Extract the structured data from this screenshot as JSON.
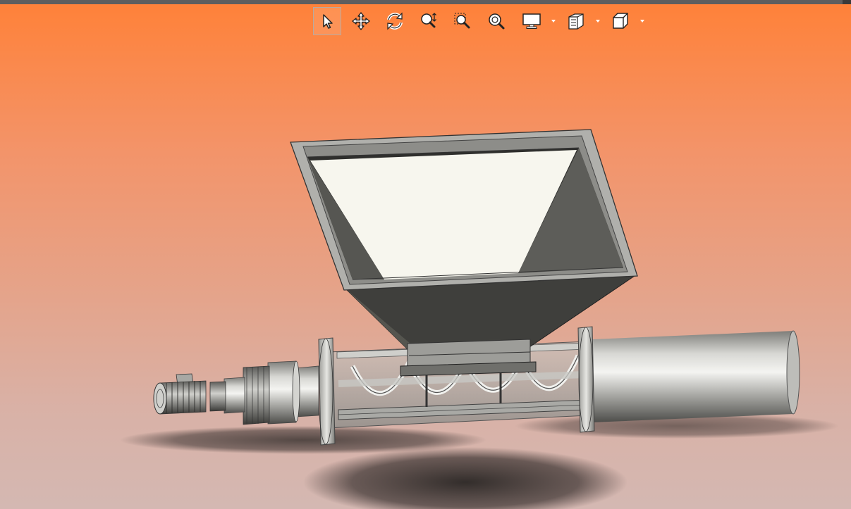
{
  "app": {
    "view": "3D CAD viewport"
  },
  "toolbar": {
    "tools": [
      {
        "icon": "select-arrow-icon",
        "active": true
      },
      {
        "icon": "pan-move-icon",
        "active": false
      },
      {
        "icon": "rotate-icon",
        "active": false
      },
      {
        "icon": "zoom-in-out-icon",
        "active": false
      },
      {
        "icon": "zoom-window-icon",
        "active": false
      },
      {
        "icon": "zoom-fit-icon",
        "active": false
      },
      {
        "icon": "display-mode-icon",
        "dropdown": true
      },
      {
        "icon": "section-view-icon",
        "dropdown": true
      },
      {
        "icon": "view-orientation-cube-icon",
        "dropdown": true
      }
    ]
  },
  "colors": {
    "background_top": "#ff8138",
    "background_bottom": "#d4b8b2",
    "steel": "#b9b9b6",
    "hopper_dark": "#3f3f3c",
    "hopper_light": "#f7f6ee"
  }
}
